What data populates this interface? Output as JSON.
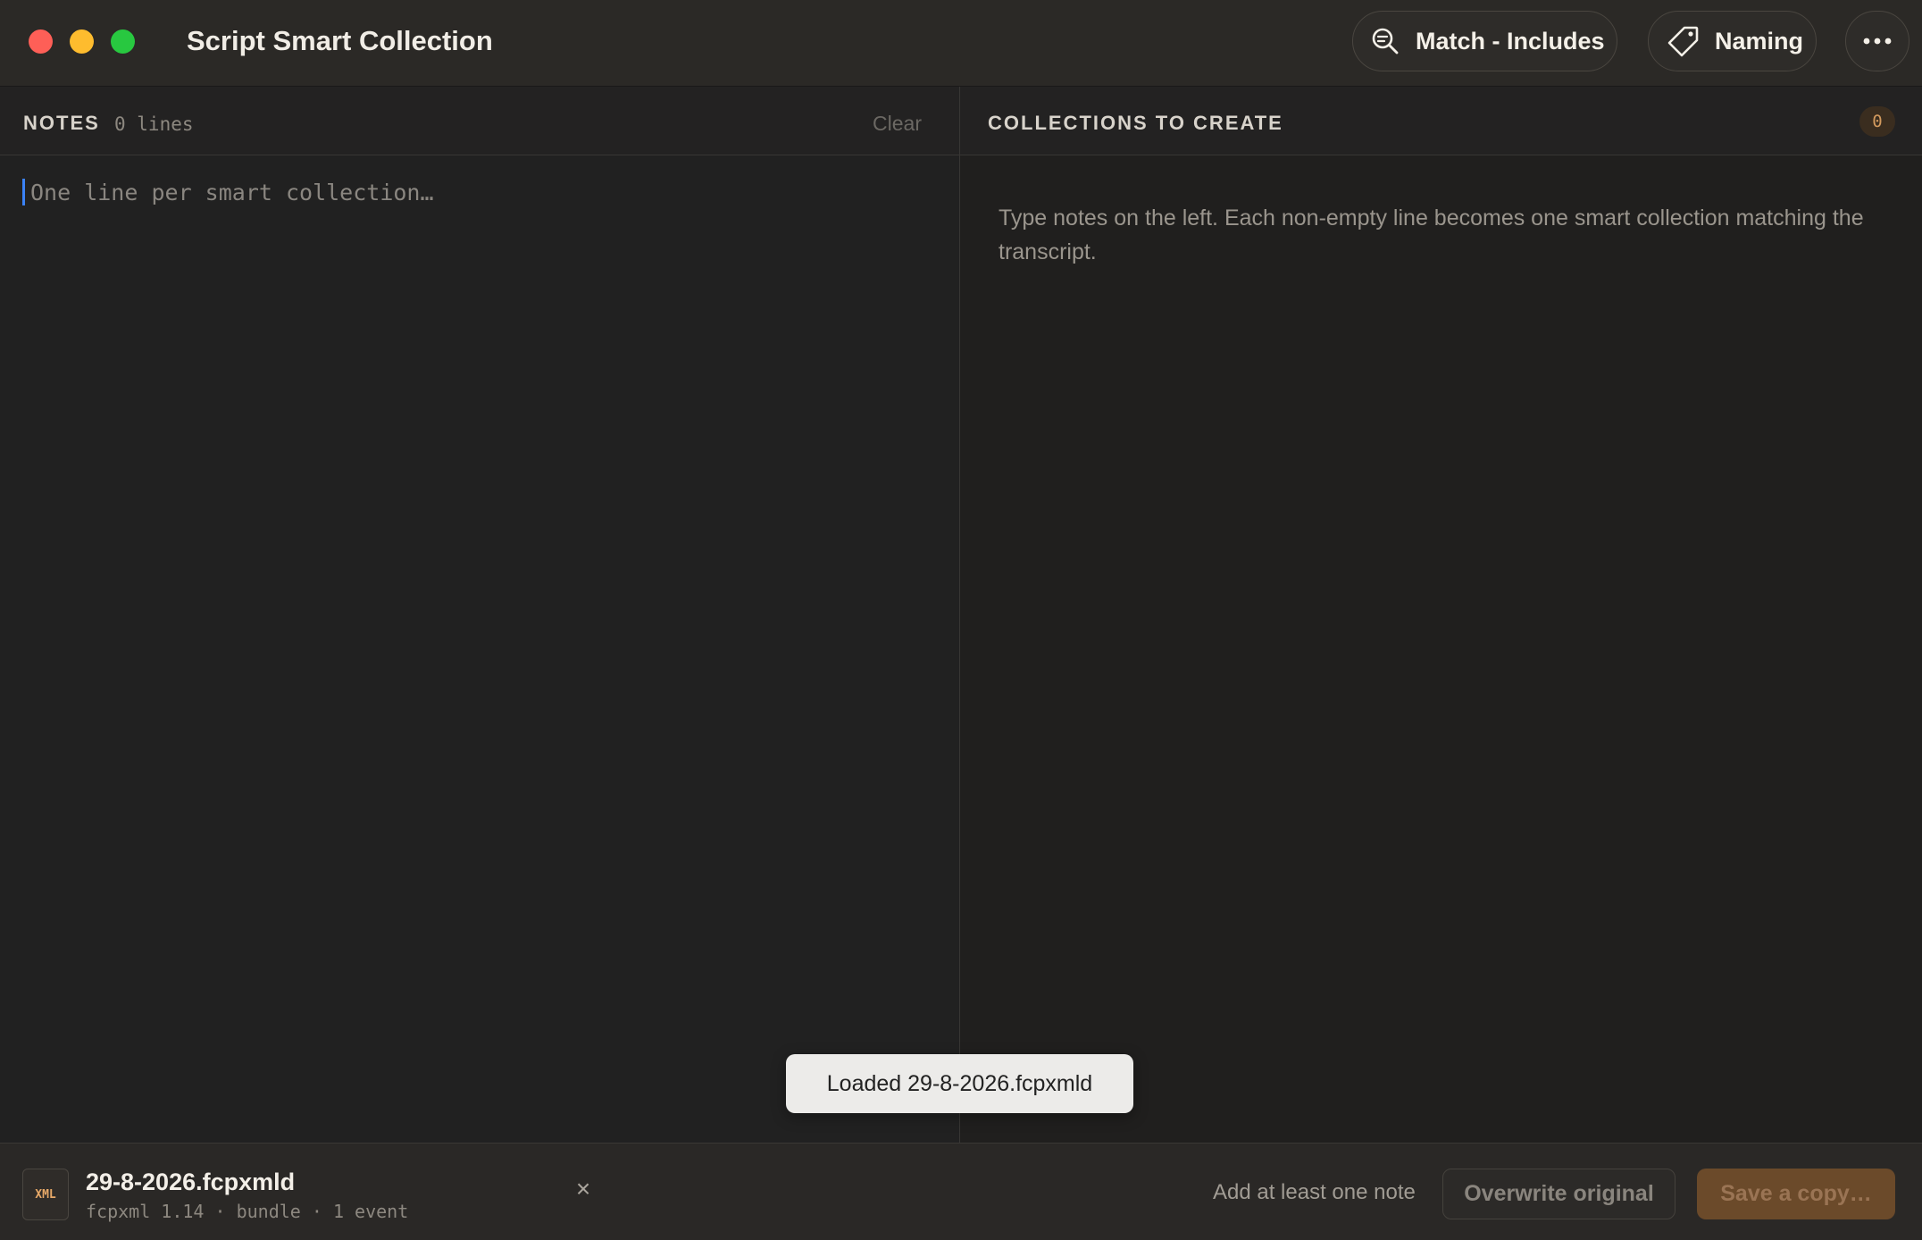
{
  "window": {
    "title": "Script Smart Collection"
  },
  "toolbar": {
    "match_label": "Match - Includes",
    "naming_label": "Naming",
    "more_label": "⋯"
  },
  "notes": {
    "title": "NOTES",
    "line_count": "0 lines",
    "clear_label": "Clear",
    "input_value": "",
    "placeholder": "One line per smart collection…"
  },
  "collections": {
    "title": "COLLECTIONS TO CREATE",
    "count": "0",
    "hint": "Type notes on the left. Each non-empty line becomes one smart collection matching the transcript."
  },
  "toast": {
    "message": "Loaded 29-8-2026.fcpxmld"
  },
  "footer": {
    "file_badge": "XML",
    "file_name": "29-8-2026.fcpxmld",
    "file_meta": "fcpxml 1.14 · bundle · 1 event",
    "close_label": "×",
    "status": "Add at least one note",
    "overwrite_label": "Overwrite original",
    "save_label": "Save a copy…"
  },
  "colors": {
    "accent": "#d39a5e",
    "caret": "#3b82f6",
    "save_button": "#6b4a2a"
  },
  "icons": {
    "match": "search-icon",
    "naming": "tag-icon",
    "more": "ellipsis-icon",
    "close": "close-icon"
  }
}
